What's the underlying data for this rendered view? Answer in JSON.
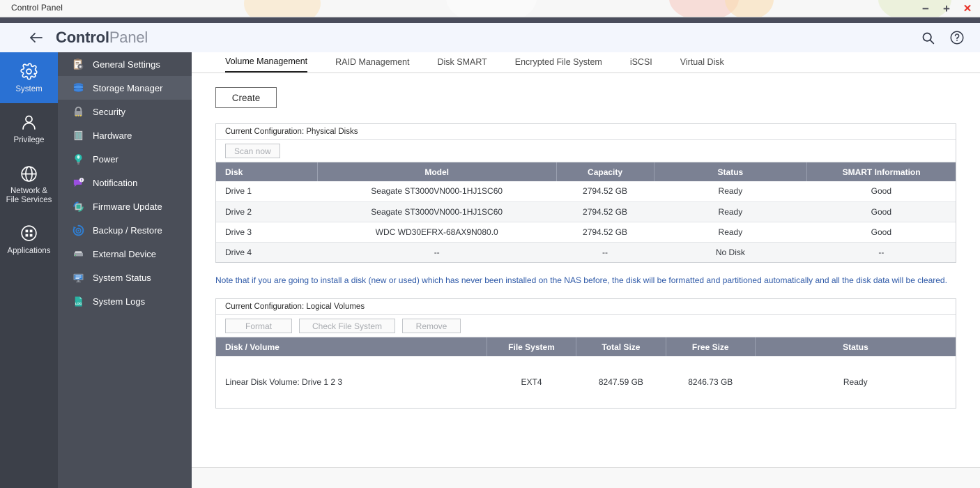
{
  "window": {
    "title": "Control Panel",
    "minimize": "−",
    "maximize": "+",
    "close": "✕"
  },
  "header": {
    "back_icon": "back-arrow-icon",
    "title_bold": "Control",
    "title_light": "Panel",
    "search_icon": "search-icon",
    "help_icon": "help-circle-icon"
  },
  "rail": {
    "items": [
      {
        "label": "System",
        "icon": "gear-icon",
        "active": true
      },
      {
        "label": "Privilege",
        "icon": "user-icon",
        "active": false
      },
      {
        "label": "Network &\nFile Services",
        "icon": "globe-icon",
        "active": false
      },
      {
        "label": "Applications",
        "icon": "grid-apps-icon",
        "active": false
      }
    ]
  },
  "sidebar": {
    "items": [
      {
        "label": "General Settings",
        "icon": "clipboard-gear-icon",
        "active": false
      },
      {
        "label": "Storage Manager",
        "icon": "database-icon",
        "active": true
      },
      {
        "label": "Security",
        "icon": "lock-icon",
        "active": false
      },
      {
        "label": "Hardware",
        "icon": "chip-icon",
        "active": false
      },
      {
        "label": "Power",
        "icon": "bulb-icon",
        "active": false
      },
      {
        "label": "Notification",
        "icon": "speech-bubble-icon",
        "active": false
      },
      {
        "label": "Firmware Update",
        "icon": "refresh-square-icon",
        "active": false
      },
      {
        "label": "Backup / Restore",
        "icon": "backup-gear-icon",
        "active": false
      },
      {
        "label": "External Device",
        "icon": "external-drive-icon",
        "active": false
      },
      {
        "label": "System Status",
        "icon": "monitor-icon",
        "active": false
      },
      {
        "label": "System Logs",
        "icon": "log-file-icon",
        "active": false
      }
    ]
  },
  "tabs": [
    {
      "label": "Volume Management",
      "active": true
    },
    {
      "label": "RAID Management",
      "active": false
    },
    {
      "label": "Disk SMART",
      "active": false
    },
    {
      "label": "Encrypted File System",
      "active": false
    },
    {
      "label": "iSCSI",
      "active": false
    },
    {
      "label": "Virtual Disk",
      "active": false
    }
  ],
  "toolbar": {
    "create_label": "Create"
  },
  "physical_disks": {
    "card_title": "Current Configuration: Physical Disks",
    "scan_label": "Scan now",
    "columns": [
      "Disk",
      "Model",
      "Capacity",
      "Status",
      "SMART Information"
    ],
    "rows": [
      {
        "disk": "Drive 1",
        "model": "Seagate ST3000VN000-1HJ1SC60",
        "capacity": "2794.52 GB",
        "status": "Ready",
        "smart": "Good",
        "smart_ok": true
      },
      {
        "disk": "Drive 2",
        "model": "Seagate ST3000VN000-1HJ1SC60",
        "capacity": "2794.52 GB",
        "status": "Ready",
        "smart": "Good",
        "smart_ok": true
      },
      {
        "disk": "Drive 3",
        "model": "WDC WD30EFRX-68AX9N080.0",
        "capacity": "2794.52 GB",
        "status": "Ready",
        "smart": "Good",
        "smart_ok": true
      },
      {
        "disk": "Drive 4",
        "model": "--",
        "capacity": "--",
        "status": "No Disk",
        "smart": "--",
        "smart_ok": false
      }
    ]
  },
  "note": "Note that if you are going to install a disk (new or used) which has never been installed on the NAS before, the disk will be formatted and partitioned automatically and all the disk data will be cleared.",
  "logical_volumes": {
    "card_title": "Current Configuration: Logical Volumes",
    "buttons": [
      "Format",
      "Check File System",
      "Remove"
    ],
    "columns": [
      "Disk / Volume",
      "File System",
      "Total Size",
      "Free Size",
      "Status"
    ],
    "rows": [
      {
        "volume": "Linear Disk Volume: Drive 1 2 3",
        "filesystem": "EXT4",
        "total": "8247.59 GB",
        "free": "8246.73 GB",
        "status": "Ready"
      }
    ]
  },
  "colors": {
    "accent": "#2a71d3",
    "rail": "#3c4049",
    "submenu": "#4a4e58",
    "table_header": "#7b8193",
    "note": "#2f5aa8",
    "smart_good": "#1b8f27"
  }
}
